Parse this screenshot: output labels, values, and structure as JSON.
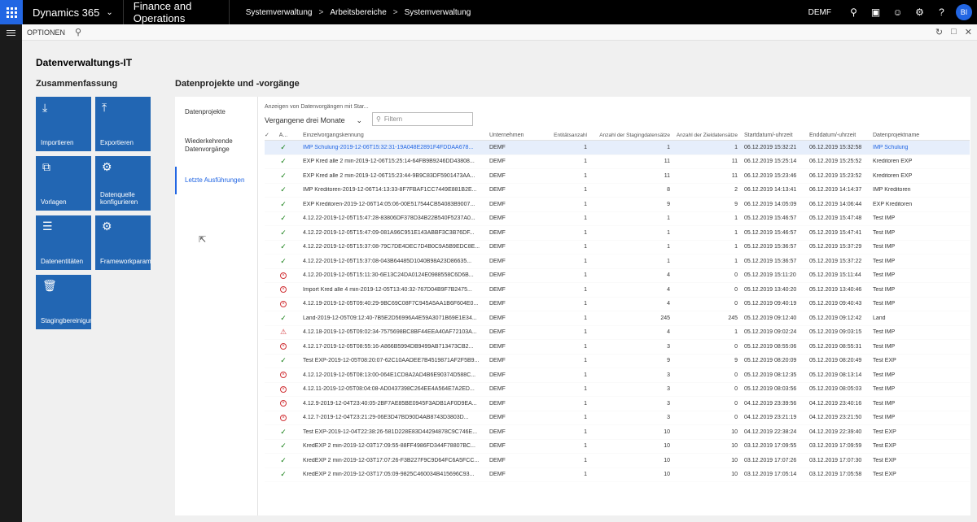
{
  "app": {
    "name": "Dynamics 365",
    "module": "Finance and Operations"
  },
  "breadcrumb": [
    "Systemverwaltung",
    "Arbeitsbereiche",
    "Systemverwaltung"
  ],
  "company": "DEMF",
  "user_initials": "BI",
  "actionbar": {
    "options_label": "OPTIONEN"
  },
  "page": {
    "title": "Datenverwaltungs-IT"
  },
  "summary": {
    "title": "Zusammenfassung",
    "tiles": [
      {
        "label": "Importieren",
        "icon": "download-icon"
      },
      {
        "label": "Exportieren",
        "icon": "upload-icon"
      },
      {
        "label": "Vorlagen",
        "icon": "copy-icon"
      },
      {
        "label": "Datenquelle konfigurieren",
        "icon": "gear-icon"
      },
      {
        "label": "Datenentitäten",
        "icon": "list-icon"
      },
      {
        "label": "Frameworkparameter",
        "icon": "gear-icon"
      },
      {
        "label": "Stagingbereinigung",
        "icon": "trash-icon"
      }
    ]
  },
  "projects": {
    "title": "Datenprojekte und -vorgänge",
    "tabs": [
      "Datenprojekte",
      "Wiederkehrende Datenvorgänge",
      "Letzte Ausführungen"
    ],
    "selected_tab": 2,
    "filter_label": "Anzeigen von Datenvorgängen mit Star...",
    "period_value": "Vergangene drei Monate",
    "filter_placeholder": "Filtern",
    "columns": {
      "status": "A...",
      "id": "Einzelvorgangskennung",
      "company": "Unternehmen",
      "entities": "Entitätsanzahl",
      "staging": "Anzahl der Stagingdatensätze",
      "target": "Anzahl der Zieldatensätze",
      "start": "Startdatum/-uhrzeit",
      "end": "Enddatum/-uhrzeit",
      "project": "Datenprojektname"
    },
    "rows": [
      {
        "status": "ok",
        "id": "IMP Schulung-2019-12-06T15:32:31-19A048E2891F4FDDAA678...",
        "company": "DEMF",
        "entities": "1",
        "staging": "1",
        "target": "1",
        "start": "06.12.2019 15:32:21",
        "end": "06.12.2019 15:32:58",
        "project": "IMP Schulung"
      },
      {
        "status": "ok",
        "id": "EXP Kred alle 2 min-2019-12-06T15:25:14-64FB9B9246DD43808...",
        "company": "DEMF",
        "entities": "1",
        "staging": "11",
        "target": "11",
        "start": "06.12.2019 15:25:14",
        "end": "06.12.2019 15:25:52",
        "project": "Kreditoren EXP"
      },
      {
        "status": "ok",
        "id": "EXP Kred alle 2 min-2019-12-06T15:23:44-9B9C83DF5901473AA...",
        "company": "DEMF",
        "entities": "1",
        "staging": "11",
        "target": "11",
        "start": "06.12.2019 15:23:46",
        "end": "06.12.2019 15:23:52",
        "project": "Kreditoren EXP"
      },
      {
        "status": "ok",
        "id": "IMP Kreditoren-2019-12-06T14:13:33-8F7FBAF1CC7449E881B2E...",
        "company": "DEMF",
        "entities": "1",
        "staging": "8",
        "target": "2",
        "start": "06.12.2019 14:13:41",
        "end": "06.12.2019 14:14:37",
        "project": "IMP Kreditoren"
      },
      {
        "status": "ok",
        "id": "EXP Kreditoren-2019-12-06T14:05:06-00E517544CB54083B9007...",
        "company": "DEMF",
        "entities": "1",
        "staging": "9",
        "target": "9",
        "start": "06.12.2019 14:05:09",
        "end": "06.12.2019 14:06:44",
        "project": "EXP Kreditoren"
      },
      {
        "status": "ok",
        "id": "4.12.22-2019-12-05T15:47:28-83806DF378D34B22B540F5237A0...",
        "company": "DEMF",
        "entities": "1",
        "staging": "1",
        "target": "1",
        "start": "05.12.2019 15:46:57",
        "end": "05.12.2019 15:47:48",
        "project": "Test IMP"
      },
      {
        "status": "ok",
        "id": "4.12.22-2019-12-05T15:47:09-081A96C951E143ABBF3C3B76DF...",
        "company": "DEMF",
        "entities": "1",
        "staging": "1",
        "target": "1",
        "start": "05.12.2019 15:46:57",
        "end": "05.12.2019 15:47:41",
        "project": "Test IMP"
      },
      {
        "status": "ok",
        "id": "4.12.22-2019-12-05T15:37:08-79C7DE4DEC7D4B0C9A5B9EDC8E...",
        "company": "DEMF",
        "entities": "1",
        "staging": "1",
        "target": "1",
        "start": "05.12.2019 15:36:57",
        "end": "05.12.2019 15:37:29",
        "project": "Test IMP"
      },
      {
        "status": "ok",
        "id": "4.12.22-2019-12-05T15:37:08-043B64485D1040B98A23D86635...",
        "company": "DEMF",
        "entities": "1",
        "staging": "1",
        "target": "1",
        "start": "05.12.2019 15:36:57",
        "end": "05.12.2019 15:37:22",
        "project": "Test IMP"
      },
      {
        "status": "err",
        "id": "4.12.20-2019-12-05T15:11:30-6E13C24DA0124E0988558C6D6B...",
        "company": "DEMF",
        "entities": "1",
        "staging": "4",
        "target": "0",
        "start": "05.12.2019 15:11:20",
        "end": "05.12.2019 15:11:44",
        "project": "Test IMP"
      },
      {
        "status": "err",
        "id": "Import Kred alle 4 min-2019-12-05T13:40:32-767D04B9F7B2475...",
        "company": "DEMF",
        "entities": "1",
        "staging": "4",
        "target": "0",
        "start": "05.12.2019 13:40:20",
        "end": "05.12.2019 13:40:46",
        "project": "Test IMP"
      },
      {
        "status": "err",
        "id": "4.12.19-2019-12-05T09:40:29-9BC69C08F7C945A5AA1B6F604E0...",
        "company": "DEMF",
        "entities": "1",
        "staging": "4",
        "target": "0",
        "start": "05.12.2019 09:40:19",
        "end": "05.12.2019 09:40:43",
        "project": "Test IMP"
      },
      {
        "status": "ok",
        "id": "Land-2019-12-05T09:12:40-7B5E2D56996A4E59A3071B69E1E34...",
        "company": "DEMF",
        "entities": "1",
        "staging": "245",
        "target": "245",
        "start": "05.12.2019 09:12:40",
        "end": "05.12.2019 09:12:42",
        "project": "Land"
      },
      {
        "status": "warn",
        "id": "4.12.18-2019-12-05T09:02:34-7575698BC8BF44EEA40AF72103A...",
        "company": "DEMF",
        "entities": "1",
        "staging": "4",
        "target": "1",
        "start": "05.12.2019 09:02:24",
        "end": "05.12.2019 09:03:15",
        "project": "Test IMP"
      },
      {
        "status": "err",
        "id": "4.12.17-2019-12-05T08:55:16-A866B5994DB9499AB713473CB2...",
        "company": "DEMF",
        "entities": "1",
        "staging": "3",
        "target": "0",
        "start": "05.12.2019 08:55:06",
        "end": "05.12.2019 08:55:31",
        "project": "Test IMP"
      },
      {
        "status": "ok",
        "id": "Test EXP-2019-12-05T08:20:07-62C10AADEE7B4519871AF2F5B9...",
        "company": "DEMF",
        "entities": "1",
        "staging": "9",
        "target": "9",
        "start": "05.12.2019 08:20:09",
        "end": "05.12.2019 08:20:49",
        "project": "Test EXP"
      },
      {
        "status": "err",
        "id": "4.12.12-2019-12-05T08:13:00-064E1CD8A2AD4B6E90374D588C...",
        "company": "DEMF",
        "entities": "1",
        "staging": "3",
        "target": "0",
        "start": "05.12.2019 08:12:35",
        "end": "05.12.2019 08:13:14",
        "project": "Test IMP"
      },
      {
        "status": "err",
        "id": "4.12.11-2019-12-05T08:04:08-AD0437398C264EE4A564E7A2ED...",
        "company": "DEMF",
        "entities": "1",
        "staging": "3",
        "target": "0",
        "start": "05.12.2019 08:03:56",
        "end": "05.12.2019 08:05:03",
        "project": "Test IMP"
      },
      {
        "status": "err",
        "id": "4.12.9-2019-12-04T23:40:05-2BF7AE85BE0945F3ADB1AF0D9EA...",
        "company": "DEMF",
        "entities": "1",
        "staging": "3",
        "target": "0",
        "start": "04.12.2019 23:39:56",
        "end": "04.12.2019 23:40:16",
        "project": "Test IMP"
      },
      {
        "status": "err",
        "id": "4.12.7-2019-12-04T23:21:29-06E3D47BD90D4AB8743D3803D...",
        "company": "DEMF",
        "entities": "1",
        "staging": "3",
        "target": "0",
        "start": "04.12.2019 23:21:19",
        "end": "04.12.2019 23:21:50",
        "project": "Test IMP"
      },
      {
        "status": "ok",
        "id": "Test EXP-2019-12-04T22:38:26-581D228E83D44294878C9C746E...",
        "company": "DEMF",
        "entities": "1",
        "staging": "10",
        "target": "10",
        "start": "04.12.2019 22:38:24",
        "end": "04.12.2019 22:39:40",
        "project": "Test EXP"
      },
      {
        "status": "ok",
        "id": "KredEXP 2 min-2019-12-03T17:09:55-88FF4986FD344F78807BC...",
        "company": "DEMF",
        "entities": "1",
        "staging": "10",
        "target": "10",
        "start": "03.12.2019 17:09:55",
        "end": "03.12.2019 17:09:59",
        "project": "Test EXP"
      },
      {
        "status": "ok",
        "id": "KredEXP 2 min-2019-12-03T17:07:26-F3B227F9C9D64FC6A5FCC...",
        "company": "DEMF",
        "entities": "1",
        "staging": "10",
        "target": "10",
        "start": "03.12.2019 17:07:26",
        "end": "03.12.2019 17:07:30",
        "project": "Test EXP"
      },
      {
        "status": "ok",
        "id": "KredEXP 2 min-2019-12-03T17:05:09-9825C460034B415696C93...",
        "company": "DEMF",
        "entities": "1",
        "staging": "10",
        "target": "10",
        "start": "03.12.2019 17:05:14",
        "end": "03.12.2019 17:05:58",
        "project": "Test EXP"
      }
    ]
  }
}
